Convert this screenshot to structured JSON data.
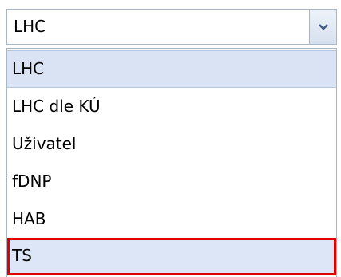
{
  "combo": {
    "value": "LHC",
    "icon": "chevron-down-icon"
  },
  "dropdown": {
    "items": [
      {
        "label": "LHC",
        "selected": true
      },
      {
        "label": "LHC dle KÚ"
      },
      {
        "label": "Uživatel"
      },
      {
        "label": "fDNP"
      },
      {
        "label": "HAB"
      },
      {
        "label": "TS",
        "highlighted": true
      }
    ]
  },
  "colors": {
    "selection": "#dae3f3",
    "highlight_border": "#e00000",
    "border": "#a9b6c8"
  }
}
